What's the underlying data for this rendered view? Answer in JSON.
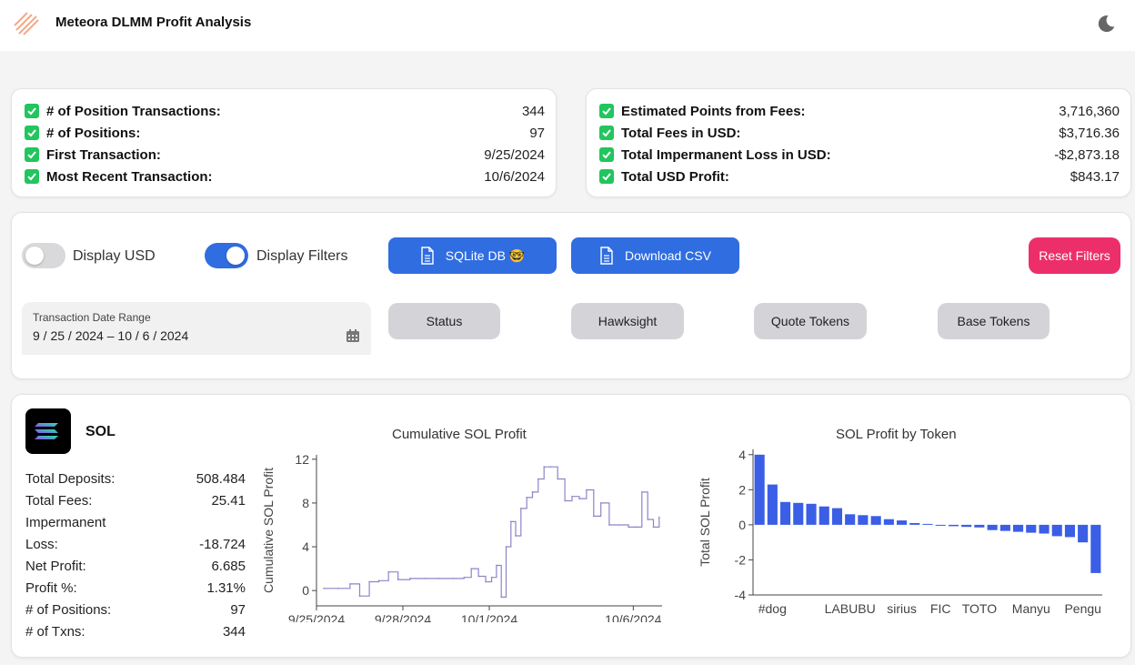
{
  "app": {
    "title": "Meteora DLMM Profit Analysis",
    "accent_color": "#2f6de1",
    "danger_color": "#ec2f6a",
    "check_color": "#22c55e"
  },
  "summary_left": [
    {
      "label": "# of Position Transactions:",
      "value": "344"
    },
    {
      "label": "# of Positions:",
      "value": "97"
    },
    {
      "label": "First Transaction:",
      "value": "9/25/2024"
    },
    {
      "label": "Most Recent Transaction:",
      "value": "10/6/2024"
    }
  ],
  "summary_right": [
    {
      "label": "Estimated Points from Fees:",
      "value": "3,716,360"
    },
    {
      "label": "Total Fees in USD:",
      "value": "$3,716.36"
    },
    {
      "label": "Total Impermanent Loss in USD:",
      "value": "-$2,873.18"
    },
    {
      "label": "Total USD Profit:",
      "value": "$843.17"
    }
  ],
  "controls": {
    "display_usd_label": "Display USD",
    "display_usd_on": false,
    "display_filters_label": "Display Filters",
    "display_filters_on": true,
    "sqlite_label": "SQLite DB 🤓",
    "csv_label": "Download CSV",
    "reset_label": "Reset Filters",
    "file_icon": "file-icon"
  },
  "filters": {
    "date_caption": "Transaction Date Range",
    "date_range": "9 / 25 / 2024  –  10 / 6 / 2024",
    "calendar_icon": "calendar-icon",
    "status_label": "Status",
    "hawksight_label": "Hawksight",
    "quote_tokens_label": "Quote Tokens",
    "base_tokens_label": "Base Tokens"
  },
  "sol": {
    "title": "SOL",
    "metrics": [
      {
        "label": "Total Deposits:",
        "value": "508.484"
      },
      {
        "label": "Total Fees:",
        "value": "25.41"
      },
      {
        "label": "Impermanent",
        "value": ""
      },
      {
        "label": "Loss:",
        "value": "-18.724"
      },
      {
        "label": "Net Profit:",
        "value": "6.685"
      },
      {
        "label": "Profit %:",
        "value": "1.31%"
      },
      {
        "label": "# of Positions:",
        "value": "97"
      },
      {
        "label": "# of Txns:",
        "value": "344"
      }
    ]
  },
  "chart_data": [
    {
      "type": "line",
      "title": "Cumulative SOL Profit",
      "ylabel": "Cumulative SOL Profit",
      "xlabel": "",
      "x_tick_labels": [
        "9/25/2024",
        "9/28/2024",
        "10/1/2024",
        "10/6/2024"
      ],
      "y_ticks": [
        0,
        4,
        8,
        12
      ],
      "ylim": [
        -1,
        12
      ],
      "color": "#8b86c9",
      "grid": false,
      "x": [
        "2024-09-25",
        "2024-09-25",
        "2024-09-26",
        "2024-09-26",
        "2024-09-26",
        "2024-09-27",
        "2024-09-27",
        "2024-09-27",
        "2024-09-28",
        "2024-09-28",
        "2024-09-29",
        "2024-09-29",
        "2024-09-30",
        "2024-09-30",
        "2024-09-30",
        "2024-09-30",
        "2024-10-01",
        "2024-10-01",
        "2024-10-01",
        "2024-10-01",
        "2024-10-01",
        "2024-10-01",
        "2024-10-02",
        "2024-10-02",
        "2024-10-02",
        "2024-10-02",
        "2024-10-02",
        "2024-10-03",
        "2024-10-03",
        "2024-10-03",
        "2024-10-03",
        "2024-10-04",
        "2024-10-04",
        "2024-10-04",
        "2024-10-04",
        "2024-10-05",
        "2024-10-05",
        "2024-10-05",
        "2024-10-06",
        "2024-10-06",
        "2024-10-06",
        "2024-10-06",
        "2024-10-06"
      ],
      "y": [
        0.2,
        0.2,
        0.6,
        -0.5,
        0.8,
        0.9,
        1.7,
        1.0,
        1.1,
        1.1,
        1.1,
        1.1,
        1.2,
        2.0,
        1.3,
        0.8,
        1.2,
        2.3,
        -0.6,
        4.0,
        6.3,
        5.0,
        7.5,
        8.5,
        9.0,
        10.2,
        11.3,
        11.3,
        10.2,
        8.2,
        8.6,
        8.4,
        9.2,
        6.8,
        8.0,
        6.0,
        6.0,
        5.8,
        5.8,
        9.0,
        6.5,
        5.8,
        6.7
      ]
    },
    {
      "type": "bar",
      "title": "SOL Profit by Token",
      "ylabel": "Total SOL Profit",
      "xlabel": "",
      "y_ticks": [
        -4,
        -2,
        0,
        2,
        4
      ],
      "ylim": [
        -4,
        4.3
      ],
      "color": "#3b5ee6",
      "grid": false,
      "categories": [
        "",
        "#dog",
        "",
        "",
        "",
        "",
        "",
        "LABUBU",
        "",
        "",
        "",
        "sirius",
        "",
        "",
        "FIC",
        "",
        "",
        "TOTO",
        "",
        "",
        "",
        "Manyu",
        "",
        "",
        "",
        "Pengu",
        ""
      ],
      "values": [
        4.0,
        2.3,
        1.3,
        1.25,
        1.2,
        1.05,
        0.95,
        0.6,
        0.55,
        0.5,
        0.32,
        0.25,
        0.1,
        0.05,
        -0.05,
        -0.08,
        -0.12,
        -0.15,
        -0.3,
        -0.35,
        -0.4,
        -0.45,
        -0.5,
        -0.65,
        -0.7,
        -1.0,
        -2.75
      ]
    }
  ]
}
